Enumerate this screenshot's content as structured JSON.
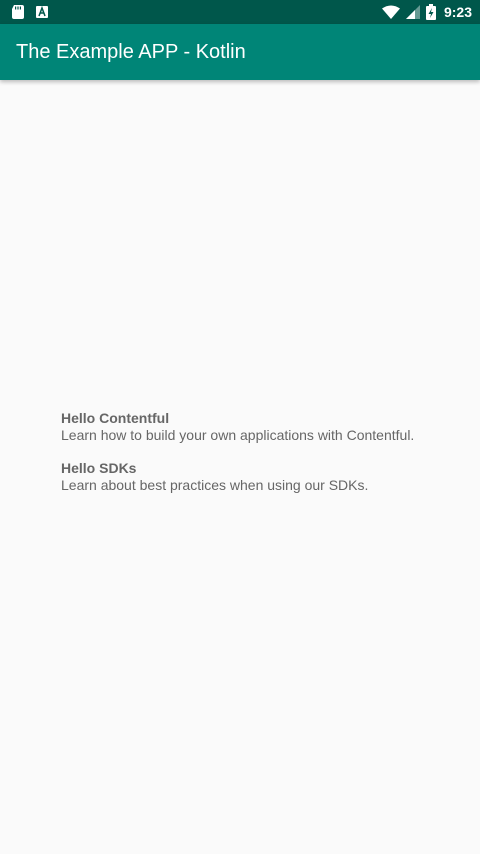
{
  "status_bar": {
    "time": "9:23",
    "icons": [
      "sd-card-icon",
      "keyboard-a-icon",
      "wifi-icon",
      "signal-icon",
      "battery-charging-icon"
    ],
    "background": "#00574b"
  },
  "app_bar": {
    "title": "The Example APP - Kotlin",
    "background": "#008577"
  },
  "list": {
    "items": [
      {
        "title": "Hello Contentful",
        "description": "Learn how to build your own applications with Contentful."
      },
      {
        "title": "Hello SDKs",
        "description": "Learn about best practices when using our SDKs."
      }
    ]
  },
  "colors": {
    "background": "#fafafa",
    "text_secondary": "#666666"
  }
}
